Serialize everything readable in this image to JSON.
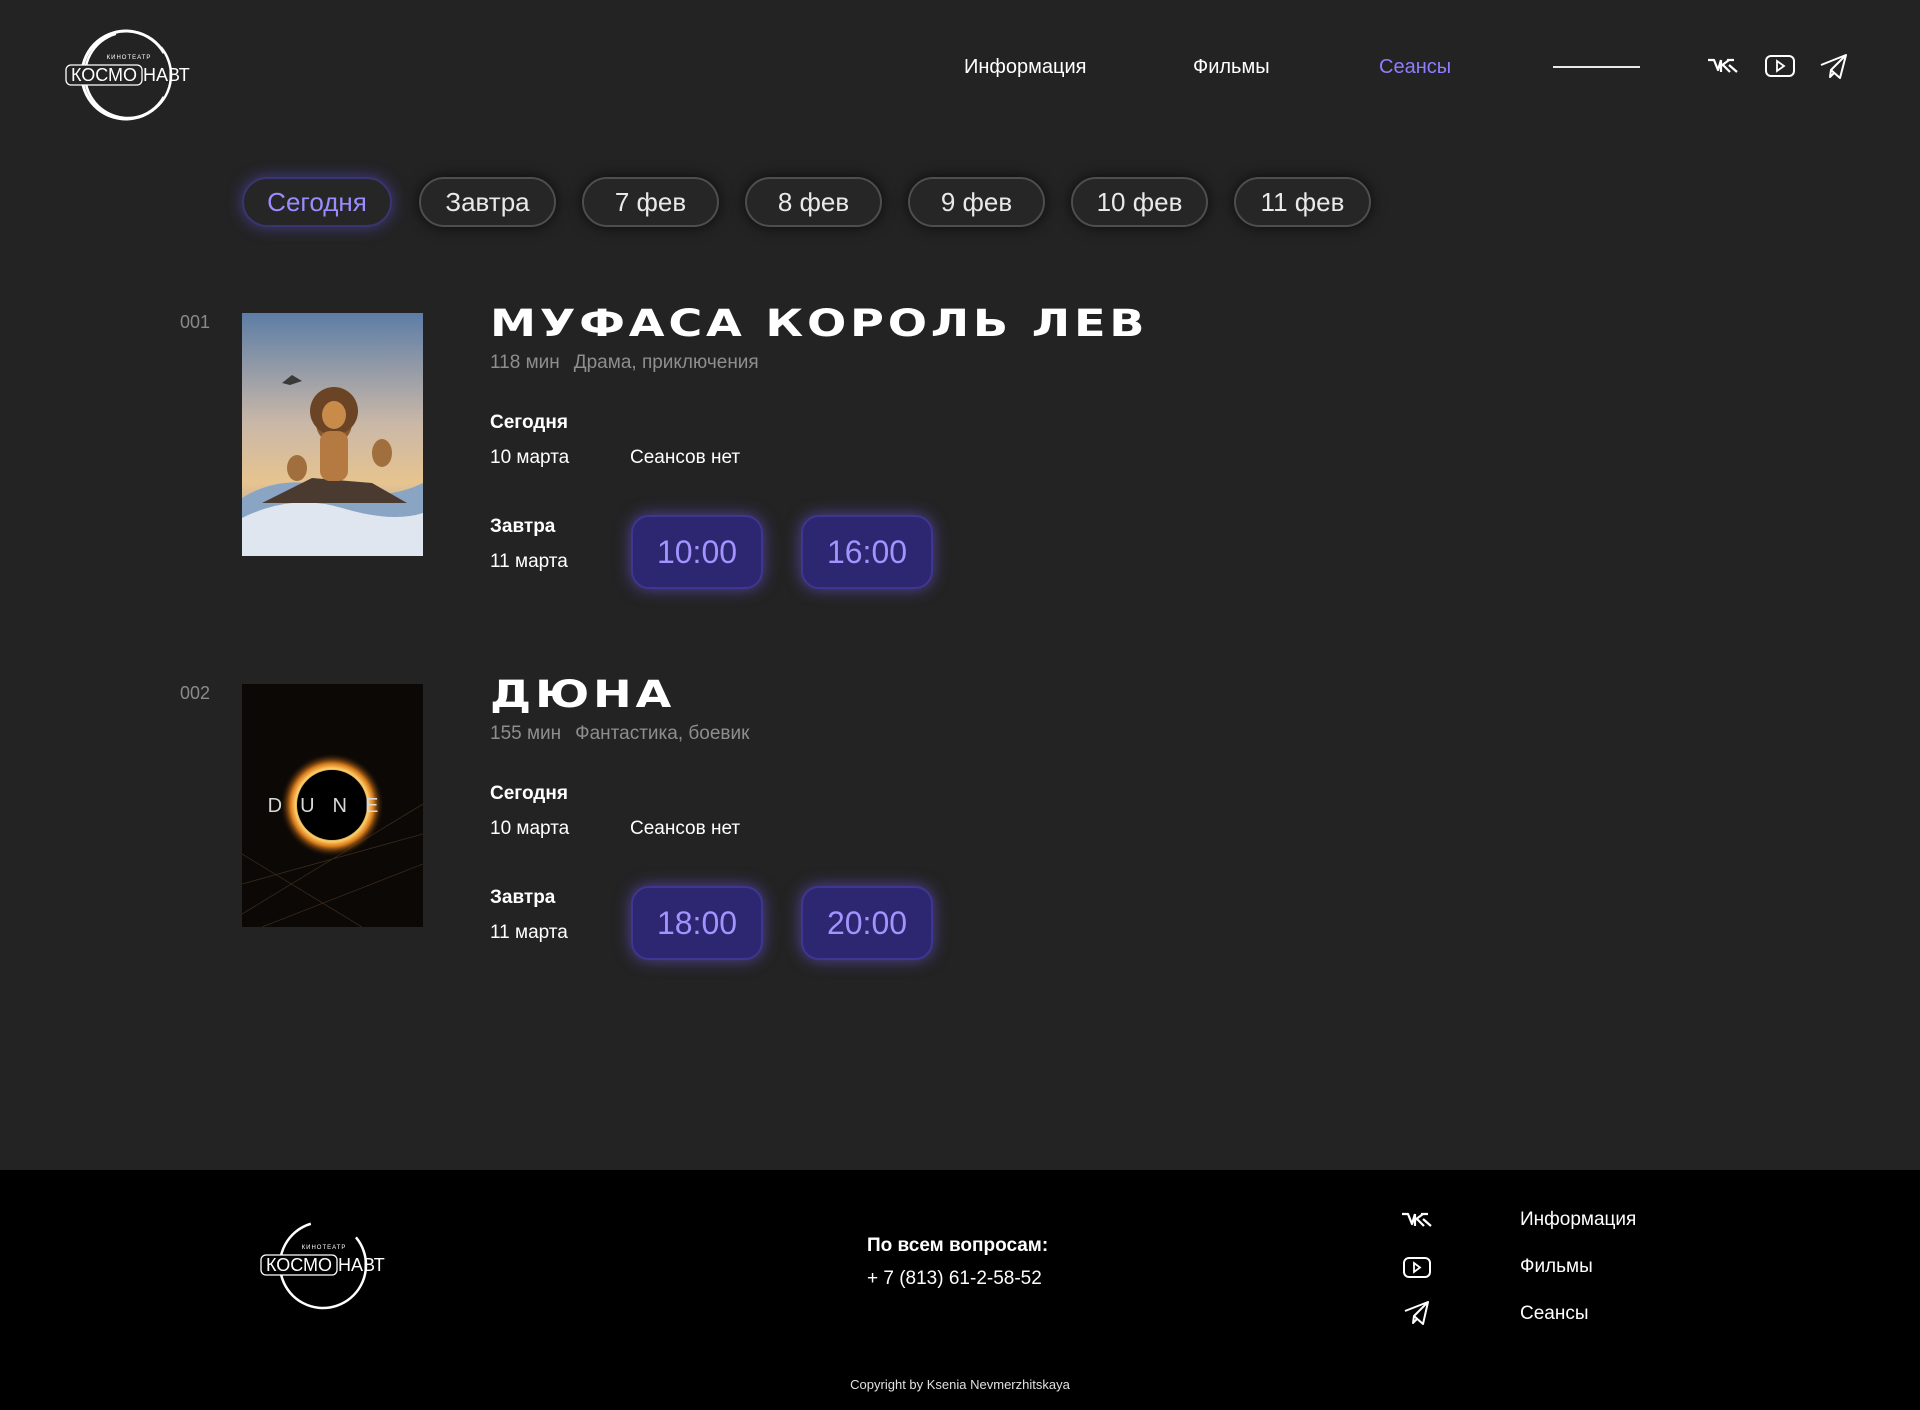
{
  "brand": {
    "small": "КИНОТЕАТР",
    "name_boxed": "КОСМО",
    "name_rest": "НАВТ"
  },
  "nav": {
    "items": [
      {
        "label": "Информация",
        "active": false
      },
      {
        "label": "Фильмы",
        "active": false
      },
      {
        "label": "Сеансы",
        "active": true
      }
    ]
  },
  "social": [
    "vk-icon",
    "youtube-icon",
    "telegram-icon"
  ],
  "date_tabs": [
    {
      "label": "Сегодня",
      "active": true
    },
    {
      "label": "Завтра",
      "active": false
    },
    {
      "label": "7 фев",
      "active": false
    },
    {
      "label": "8 фев",
      "active": false
    },
    {
      "label": "9 фев",
      "active": false
    },
    {
      "label": "10 фев",
      "active": false
    },
    {
      "label": "11 фев",
      "active": false
    }
  ],
  "films": [
    {
      "number": "001",
      "title": "МУФАСА КОРОЛЬ ЛЕВ",
      "duration": "118 мин",
      "genres": "Драма, приключения",
      "today": {
        "label": "Сегодня",
        "date": "10 марта",
        "no_shows": "Сеансов нет"
      },
      "tomorrow": {
        "label": "Завтра",
        "date": "11 марта",
        "times": [
          "10:00",
          "16:00"
        ]
      }
    },
    {
      "number": "002",
      "title": "ДЮНА",
      "duration": "155 мин",
      "genres": "Фантастика, боевик",
      "today": {
        "label": "Сегодня",
        "date": "10 марта",
        "no_shows": "Сеансов нет"
      },
      "tomorrow": {
        "label": "Завтра",
        "date": "11 марта",
        "times": [
          "18:00",
          "20:00"
        ]
      }
    }
  ],
  "footer": {
    "contact_label": "По всем вопросам:",
    "phone": "+ 7 (813) 61-2-58-52",
    "links": [
      "Информация",
      "Фильмы",
      "Сеансы"
    ],
    "copyright": "Copyright by Ksenia Nevmerzhitskaya"
  },
  "colors": {
    "accent": "#8f7dff",
    "time_bg": "#2d2670",
    "bg": "#232323",
    "footer_bg": "#000000"
  }
}
